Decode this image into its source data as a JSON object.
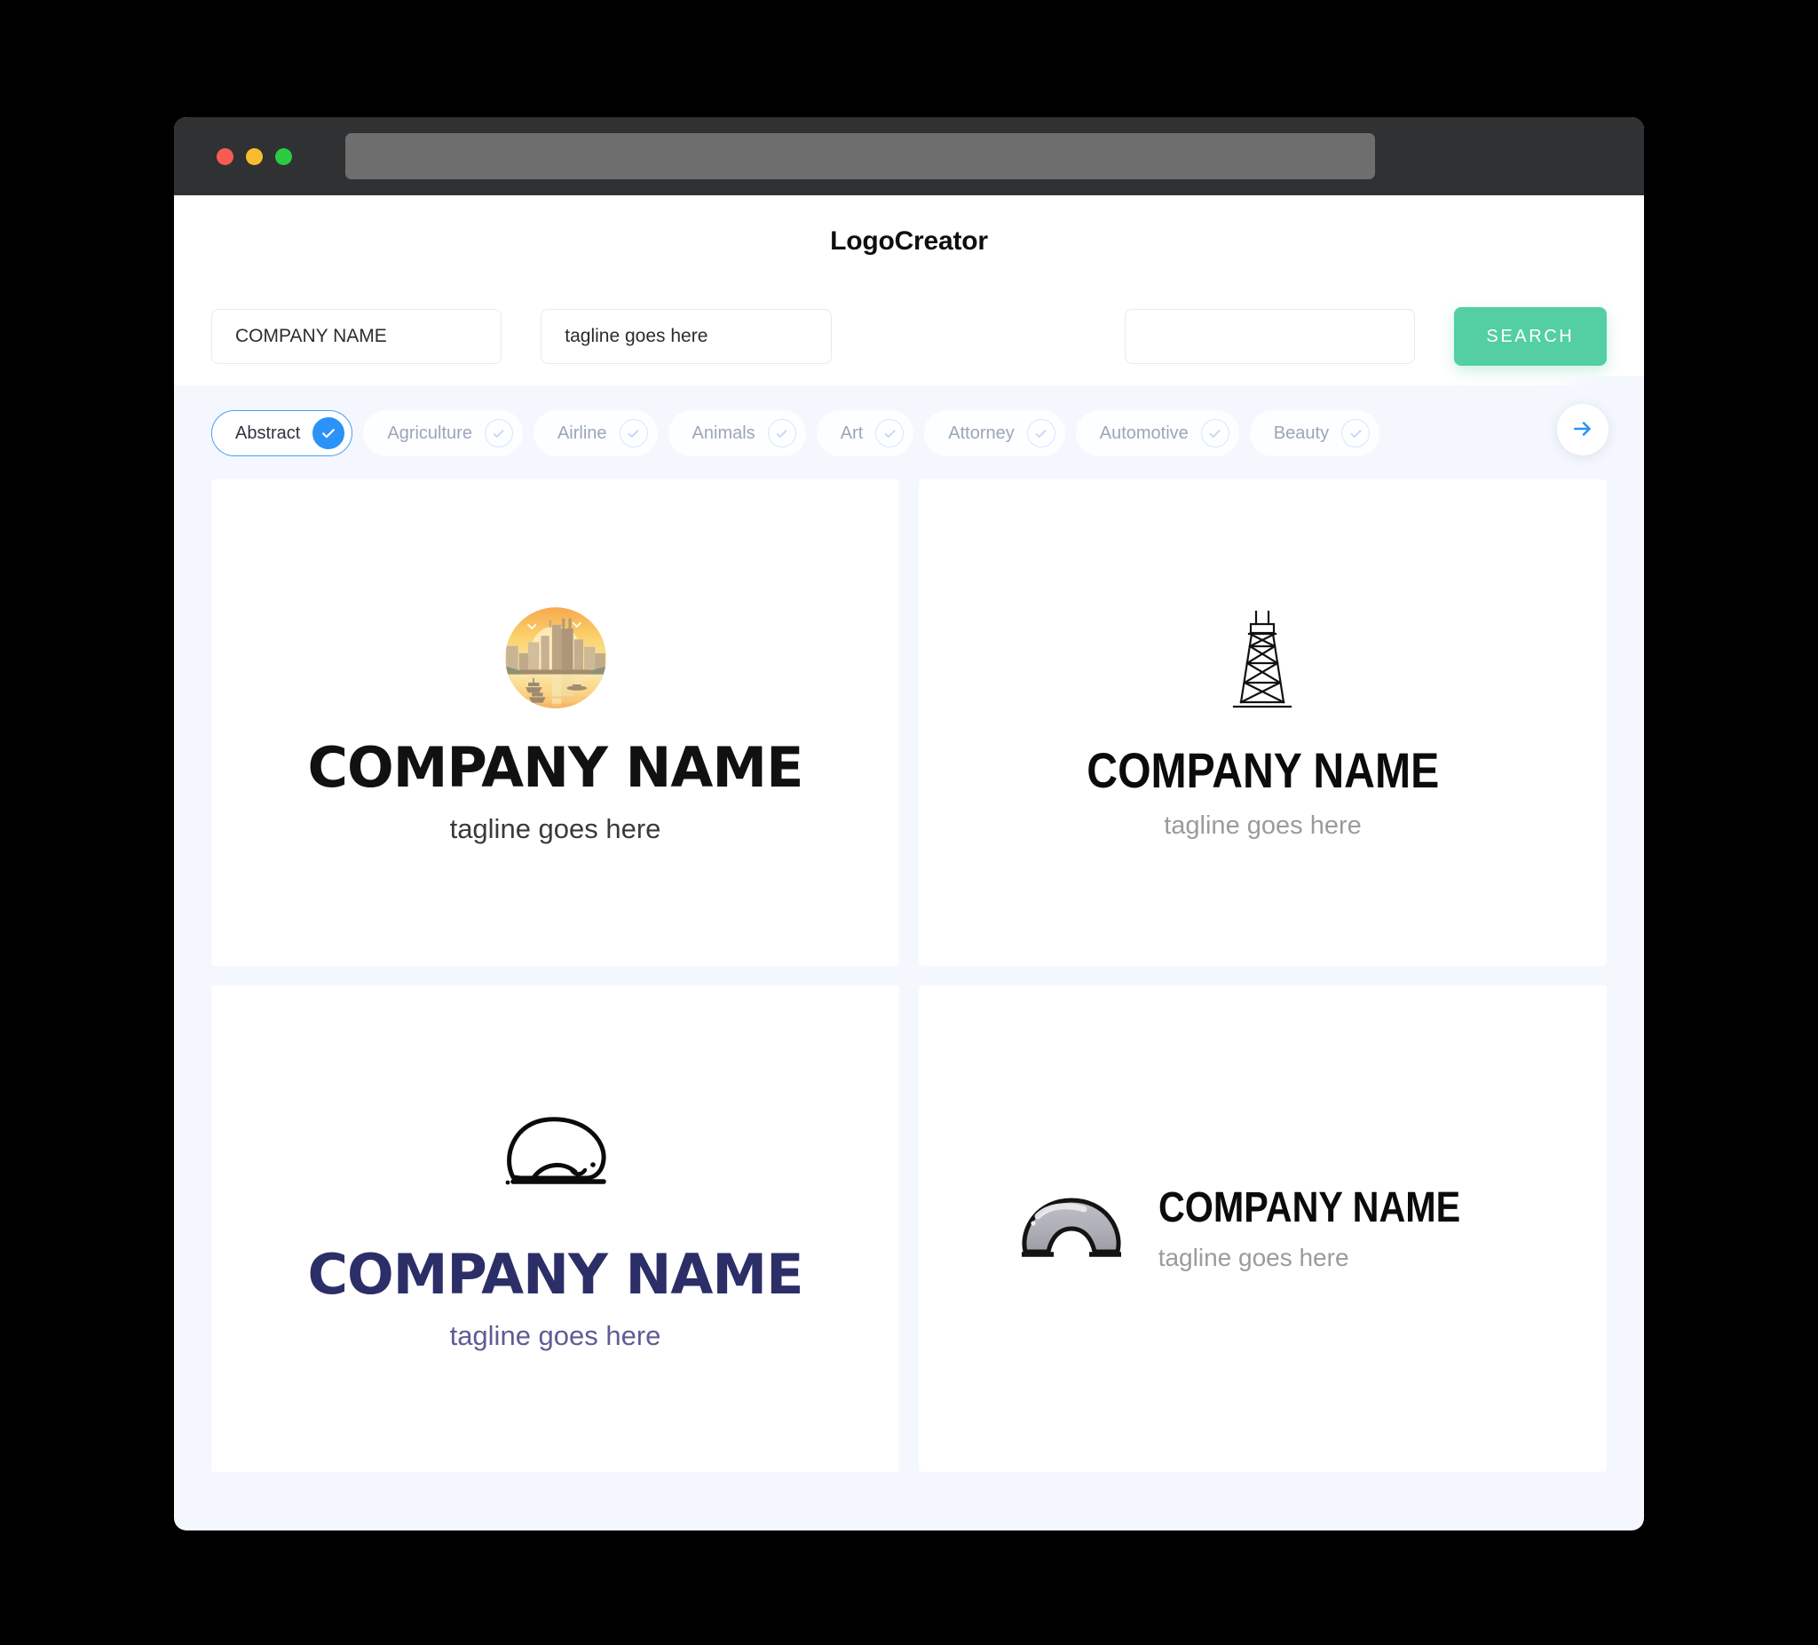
{
  "window": {
    "traffic_lights": [
      "close",
      "minimize",
      "maximize"
    ],
    "address_value": "",
    "colors": {
      "titlebar": "#2F3133",
      "address_field": "#6E6E6E",
      "close": "#F95B51",
      "minimize": "#F8BD2E",
      "maximize": "#2ACB42",
      "page_bg": "#F4F7FD",
      "accent_green": "#54CFA3",
      "accent_blue": "#2B93F7"
    }
  },
  "header": {
    "app_title": "LogoCreator"
  },
  "search": {
    "company_value": "COMPANY NAME",
    "company_placeholder": "COMPANY NAME",
    "tagline_value": "tagline goes here",
    "tagline_placeholder": "tagline goes here",
    "third_value": "",
    "third_placeholder": "",
    "search_button_label": "SEARCH"
  },
  "categories": {
    "scroll_next_icon": "arrow-right-icon",
    "items": [
      {
        "label": "Abstract",
        "selected": true
      },
      {
        "label": "Agriculture",
        "selected": false
      },
      {
        "label": "Airline",
        "selected": false
      },
      {
        "label": "Animals",
        "selected": false
      },
      {
        "label": "Art",
        "selected": false
      },
      {
        "label": "Attorney",
        "selected": false
      },
      {
        "label": "Automotive",
        "selected": false
      },
      {
        "label": "Beauty",
        "selected": false
      }
    ]
  },
  "results": [
    {
      "icon": "city-skyline-sunset-icon",
      "name": "COMPANY NAME",
      "tagline": "tagline goes here",
      "name_color": "#111111",
      "tagline_color": "#3A3A3A",
      "layout": "stacked"
    },
    {
      "icon": "oil-derrick-tower-icon",
      "name": "COMPANY NAME",
      "tagline": "tagline goes here",
      "name_color": "#0B0B0B",
      "tagline_color": "#9B9B9B",
      "layout": "stacked"
    },
    {
      "icon": "sleeping-blob-creature-icon",
      "name": "COMPANY NAME",
      "tagline": "tagline goes here",
      "name_color": "#2C2E68",
      "tagline_color": "#5B5E93",
      "layout": "stacked"
    },
    {
      "icon": "grey-arch-bridge-icon",
      "name": "COMPANY NAME",
      "tagline": "tagline goes here",
      "name_color": "#0B0B0B",
      "tagline_color": "#9B9B9B",
      "layout": "horizontal"
    }
  ]
}
